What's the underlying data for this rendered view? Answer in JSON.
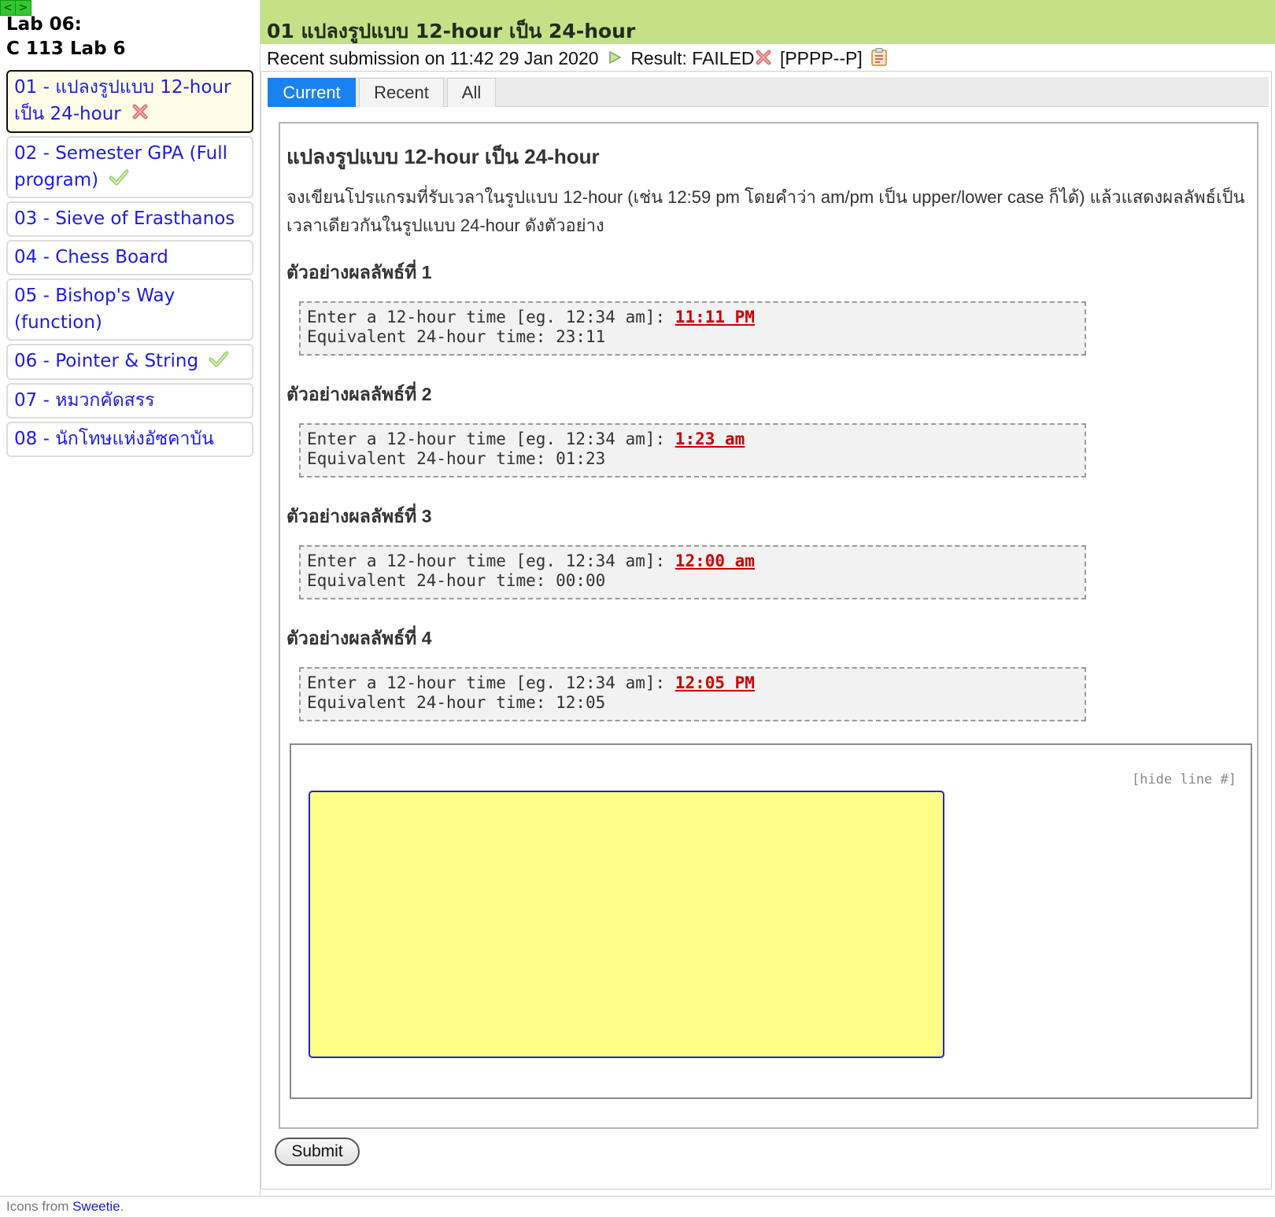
{
  "nav": {
    "prev": "<",
    "next": ">"
  },
  "sidebar": {
    "lab_title_line1": "Lab 06:",
    "lab_title_line2": "C 113 Lab 6",
    "items": [
      {
        "label_line1": "01 - แปลงรูปแบบ 12-hour",
        "label_line2": "เป็น 24-hour",
        "status": "failed"
      },
      {
        "label_line1": "02 - Semester GPA (Full",
        "label_line2": "program)",
        "status": "passed"
      },
      {
        "label": "03 - Sieve of Erasthanos",
        "status": "none"
      },
      {
        "label": "04 - Chess Board",
        "status": "none"
      },
      {
        "label": "05 - Bishop's Way (function)",
        "status": "none"
      },
      {
        "label": "06 - Pointer & String",
        "status": "passed"
      },
      {
        "label": "07 - หมวกคัดสรร",
        "status": "none"
      },
      {
        "label": "08 - นักโทษแห่งอัซคาบัน",
        "status": "none"
      }
    ]
  },
  "header": {
    "title": "01 แปลงรูปแบบ 12-hour เป็น 24-hour",
    "submission_text": "Recent submission on 11:42 29 Jan 2020",
    "result_label": "Result: FAILED",
    "result_code": "[PPPP--P]"
  },
  "tabs": [
    "Current",
    "Recent",
    "All"
  ],
  "problem": {
    "title": "แปลงรูปแบบ 12-hour เป็น 24-hour",
    "description": "จงเขียนโปรแกรมที่รับเวลาในรูปแบบ 12-hour (เช่น 12:59 pm โดยคำว่า am/pm เป็น upper/lower case ก็ได้) แล้วแสดงผลลัพธ์เป็นเวลาเดียวกันในรูปแบบ 24-hour ดังตัวอย่าง",
    "examples": [
      {
        "heading": "ตัวอย่างผลลัพธ์ที่ 1",
        "prompt": "Enter a 12-hour time [eg. 12:34 am]: ",
        "input": "11:11 PM",
        "output": "Equivalent 24-hour time: 23:11"
      },
      {
        "heading": "ตัวอย่างผลลัพธ์ที่ 2",
        "prompt": "Enter a 12-hour time [eg. 12:34 am]: ",
        "input": "1:23 am",
        "output": "Equivalent 24-hour time: 01:23"
      },
      {
        "heading": "ตัวอย่างผลลัพธ์ที่ 3",
        "prompt": "Enter a 12-hour time [eg. 12:34 am]: ",
        "input": "12:00 am",
        "output": "Equivalent 24-hour time: 00:00"
      },
      {
        "heading": "ตัวอย่างผลลัพธ์ที่ 4",
        "prompt": "Enter a 12-hour time [eg. 12:34 am]: ",
        "input": "12:05 PM",
        "output": "Equivalent 24-hour time: 12:05"
      }
    ]
  },
  "editor": {
    "hide_line_label": "[hide line #]",
    "code": ""
  },
  "submit_label": "Submit",
  "footer": {
    "prefix": "Icons from ",
    "link": "Sweetie",
    "suffix": "."
  },
  "colors": {
    "accent": "#1a82f0",
    "title_bar": "#c4e285",
    "failed": "#e07070",
    "passed": "#9ccf6a",
    "editor_bg": "#ffff88"
  }
}
